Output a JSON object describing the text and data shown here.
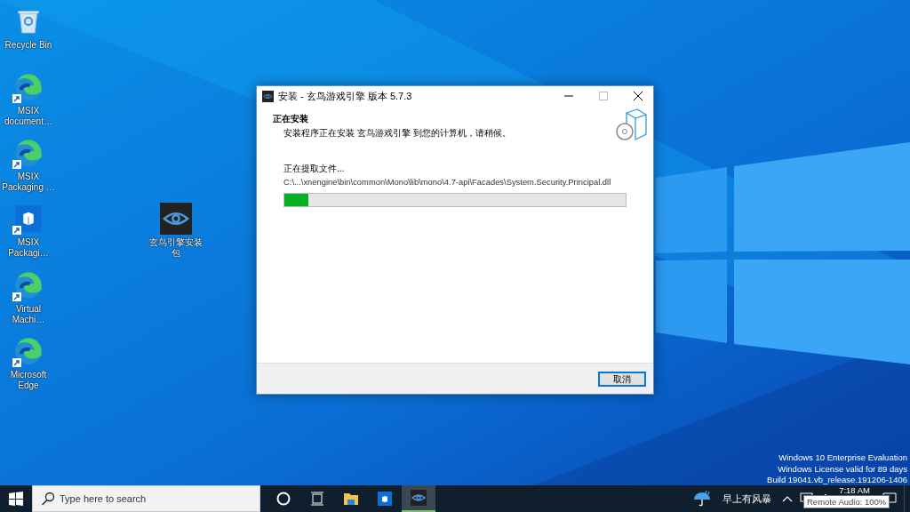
{
  "desktop_icons": [
    {
      "label": "Recycle Bin",
      "kind": "recycle",
      "shortcut": false
    },
    {
      "label": "MSIX document…",
      "kind": "edge",
      "shortcut": true
    },
    {
      "label": "MSIX Packaging …",
      "kind": "edge",
      "shortcut": true
    },
    {
      "label": "MSIX Packagi…",
      "kind": "msix",
      "shortcut": true
    },
    {
      "label": "Virtual Machi…",
      "kind": "edge",
      "shortcut": true
    },
    {
      "label": "Microsoft Edge",
      "kind": "edge",
      "shortcut": true
    },
    {
      "label": "玄鸟引擎安装包",
      "kind": "eye",
      "shortcut": false
    }
  ],
  "installer": {
    "title": "安装 - 玄鸟游戏引擎 版本 5.7.3",
    "heading": "正在安装",
    "subheading": "安装程序正在安装 玄鸟游戏引擎 到您的计算机，请稍候。",
    "status": "正在提取文件...",
    "file_path": "C:\\...\\xnengine\\bin\\common\\Mono\\lib\\mono\\4.7-api\\Facades\\System.Security.Principal.dll",
    "progress": {
      "level": 0.07
    },
    "buttons": [
      "取消"
    ]
  },
  "watermark_lines": [
    "Windows 10 Enterprise Evaluation",
    "Windows License valid for 89 days",
    "Build 19041.vb_release.191206-1406"
  ],
  "taskbar": {
    "search": {
      "placeholder": "Type here to search"
    },
    "apps": [
      {
        "kind": "cortana",
        "selected": false
      },
      {
        "kind": "taskview",
        "selected": false
      },
      {
        "kind": "explorer",
        "selected": false
      },
      {
        "kind": "store",
        "selected": false
      },
      {
        "kind": "eye",
        "selected": true
      }
    ],
    "weather": "早上有风暴",
    "time": "7:18 AM",
    "tooltip": "Remote Audio: 100%"
  }
}
